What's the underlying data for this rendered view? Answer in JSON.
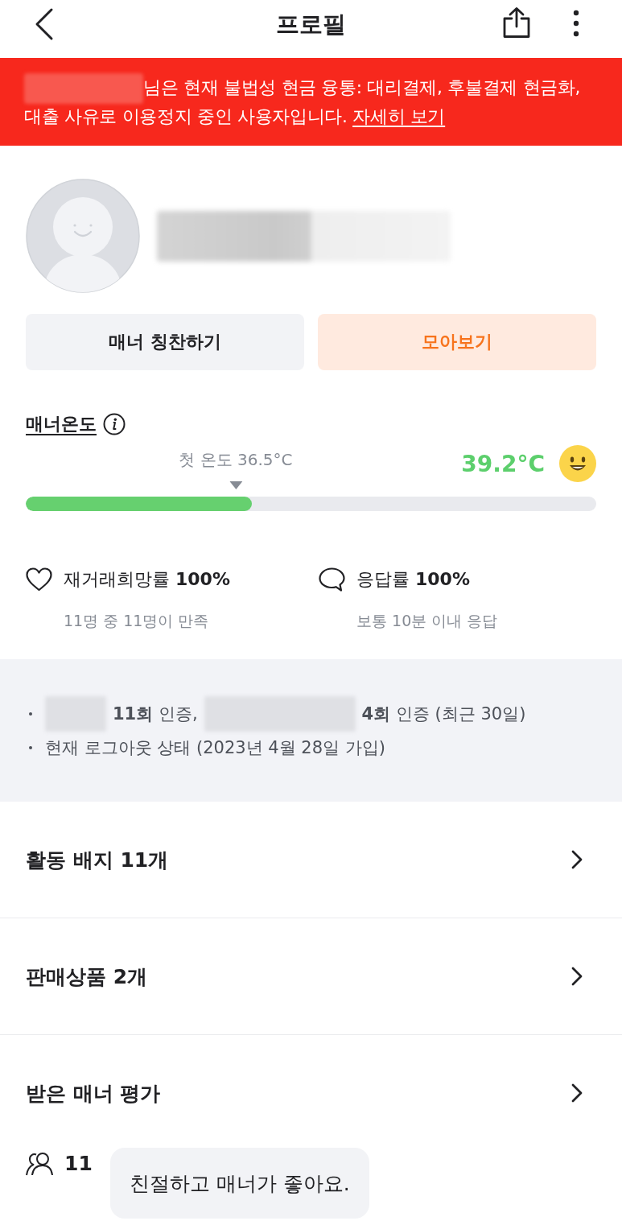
{
  "header": {
    "title": "프로필"
  },
  "banner": {
    "segments": [
      {
        "kind": "redacted"
      },
      {
        "kind": "text",
        "text": "님은 현재 불법성 현금 융통: 대리결제, 후불결제 현금화, 대출 사유로 이용정지 중인 사용자입니다. "
      },
      {
        "kind": "link",
        "text": "자세히 보기"
      }
    ]
  },
  "profile": {
    "name": {
      "kind": "redacted"
    }
  },
  "buttons": [
    {
      "label": "매너 칭찬하기",
      "kind": "secondary"
    },
    {
      "label": "모아보기",
      "kind": "accent"
    }
  ],
  "manner_temperature": {
    "label": "매너온도",
    "start_label": "첫 온도 36.5°C",
    "value": "39.2°C",
    "level": 0.396
  },
  "stats": [
    {
      "kind": "heart",
      "label": "재거래희망률 **100%**",
      "detail": "11명 중 11명이 만족"
    },
    {
      "kind": "chat",
      "label": "응답률 **100%**",
      "detail": "보통 10분 이내 응답"
    }
  ],
  "info_lines": [
    {
      "segments": [
        {
          "kind": "redacted"
        },
        {
          "kind": "text",
          "text": "**11회** 인증,"
        },
        {
          "kind": "redacted"
        },
        {
          "kind": "text",
          "text": "**4회** 인증 (최근 30일)"
        }
      ]
    },
    {
      "segments": [
        {
          "kind": "text",
          "text": "현재 로그아웃 상태 (2023년 4월 28일 가입)"
        }
      ]
    }
  ],
  "menu": [
    {
      "label": "활동 배지 11개"
    },
    {
      "label": "판매상품 2개"
    },
    {
      "label": "받은 매너 평가"
    }
  ],
  "review": {
    "count": "11",
    "comment": "친절하고 매너가 좋아요."
  }
}
